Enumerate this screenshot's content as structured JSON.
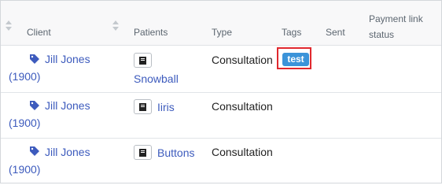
{
  "table": {
    "headers": {
      "client": "Client",
      "patients": "Patients",
      "type": "Type",
      "tags": "Tags",
      "sent": "Sent",
      "payment_status_line1": "Payment link",
      "payment_status_line2": "status"
    },
    "rows": [
      {
        "client_name": "Jill Jones",
        "client_id": "(1900)",
        "patient": "Snowball",
        "type": "Consultation",
        "tag": "test"
      },
      {
        "client_name": "Jill Jones",
        "client_id": "(1900)",
        "patient": "Iiris",
        "type": "Consultation"
      },
      {
        "client_name": "Jill Jones",
        "client_id": "(1900)",
        "patient": "Buttons",
        "type": "Consultation"
      }
    ]
  },
  "colors": {
    "link": "#3d5bbd",
    "tag_badge": "#3b93d9",
    "highlight": "#e0282e"
  },
  "icons": {
    "sort": "sort-icon",
    "client_tag": "tag-icon",
    "patient_card": "patient-card-icon"
  }
}
